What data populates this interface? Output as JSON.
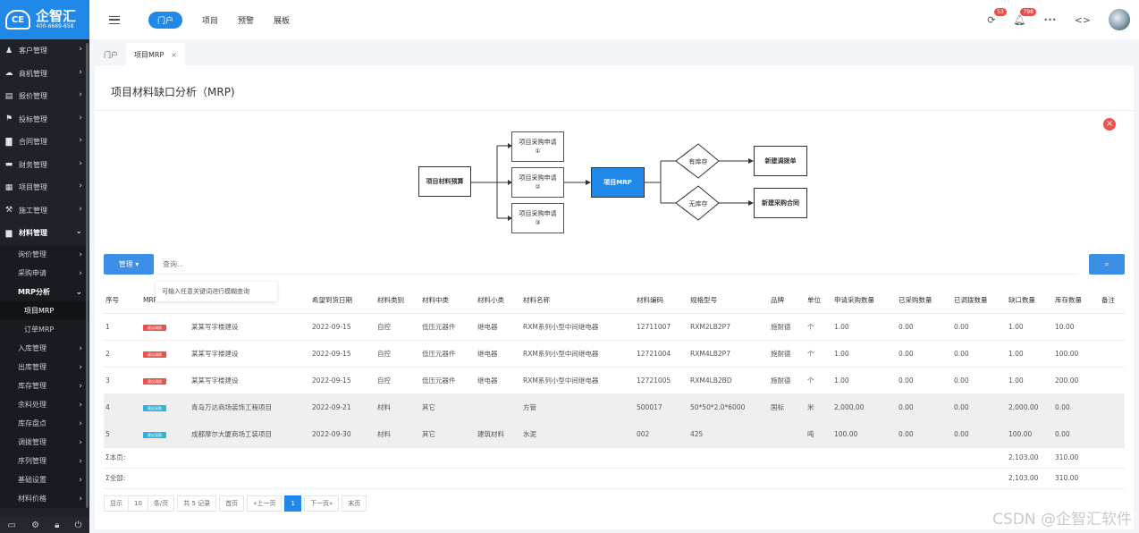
{
  "brand": {
    "name": "企智汇",
    "phone": "400-6689-658",
    "logo_mark": "CE"
  },
  "sidebar": {
    "items": [
      {
        "label": "客户管理",
        "icon": "users-icon"
      },
      {
        "label": "商机管理",
        "icon": "cloud-icon"
      },
      {
        "label": "报价管理",
        "icon": "document-icon"
      },
      {
        "label": "投标管理",
        "icon": "flag-icon"
      },
      {
        "label": "合同管理",
        "icon": "file-icon"
      },
      {
        "label": "财务管理",
        "icon": "card-icon"
      },
      {
        "label": "项目管理",
        "icon": "table-icon"
      },
      {
        "label": "施工管理",
        "icon": "wrench-icon"
      },
      {
        "label": "材料管理",
        "icon": "folder-icon"
      }
    ],
    "sub_items": [
      "询价管理",
      "采购申请",
      "MRP分析",
      "项目MRP",
      "订单MRP",
      "入库管理",
      "出库管理",
      "库存管理",
      "余料处理",
      "库存盘点",
      "调拨管理",
      "序列管理",
      "基础设置",
      "材料价格"
    ]
  },
  "topnav": {
    "items": [
      "门户",
      "项目",
      "预警",
      "展板"
    ],
    "badge1": "53",
    "badge2": "798",
    "more": "•••",
    "code": "<>"
  },
  "tabs": [
    {
      "label": "门户"
    },
    {
      "label": "项目MRP",
      "close": "×"
    }
  ],
  "page": {
    "title": "项目材料缺口分析（MRP)"
  },
  "flow": {
    "source": "项目材料预算",
    "req1": "项目采购申请",
    "req1n": "①",
    "req2": "项目采购申请",
    "req2n": "②",
    "req3": "项目采购申请",
    "req3n": "③",
    "mrp": "项目MRP",
    "has_stock": "有库存",
    "no_stock": "无库存",
    "out1": "新建调拨单",
    "out2": "新建采购合同"
  },
  "search": {
    "manage_label": "管理 ▾",
    "placeholder": "查询...",
    "tooltip": "可输入任意关键词进行模糊查询"
  },
  "table": {
    "headers": [
      "序号",
      "MRP",
      "",
      "希望到货日期",
      "材料类别",
      "材料中类",
      "材料小类",
      "材料名称",
      "材料编码",
      "规格型号",
      "品牌",
      "单位",
      "申请采购数量",
      "已采购数量",
      "已调拨数量",
      "缺口数量",
      "库存数量",
      "备注"
    ],
    "rows": [
      {
        "no": "1",
        "tag": "建议调拨",
        "proj": "某某写字楼建设",
        "date": "2022-09-15",
        "cat": "自控",
        "mid": "低压元器件",
        "small": "继电器",
        "name": "RXM系列小型中间继电器",
        "code": "12711007",
        "spec": "RXM2LB2P7",
        "brand": "施耐德",
        "unit": "个",
        "req": "1.00",
        "bought": "0.00",
        "moved": "0.00",
        "gap": "1.00",
        "stock": "10.00",
        "note": ""
      },
      {
        "no": "2",
        "tag": "建议调拨",
        "proj": "某某写字楼建设",
        "date": "2022-09-15",
        "cat": "自控",
        "mid": "低压元器件",
        "small": "继电器",
        "name": "RXM系列小型中间继电器",
        "code": "12721004",
        "spec": "RXM4LB2P7",
        "brand": "施耐德",
        "unit": "个",
        "req": "1.00",
        "bought": "0.00",
        "moved": "0.00",
        "gap": "1.00",
        "stock": "100.00",
        "note": ""
      },
      {
        "no": "3",
        "tag": "建议调拨",
        "proj": "某某写字楼建设",
        "date": "2022-09-15",
        "cat": "自控",
        "mid": "低压元器件",
        "small": "继电器",
        "name": "RXM系列小型中间继电器",
        "code": "12721005",
        "spec": "RXM4LB2BD",
        "brand": "施耐德",
        "unit": "个",
        "req": "1.00",
        "bought": "0.00",
        "moved": "0.00",
        "gap": "1.00",
        "stock": "200.00",
        "note": ""
      },
      {
        "no": "4",
        "tag": "建议采购",
        "proj": "青岛万达商场装饰工程项目",
        "date": "2022-09-21",
        "cat": "材料",
        "mid": "其它",
        "small": "",
        "name": "方管",
        "code": "500017",
        "spec": "50*50*2.0*6000",
        "brand": "国标",
        "unit": "米",
        "req": "2,000.00",
        "bought": "0.00",
        "moved": "0.00",
        "gap": "2,000.00",
        "stock": "0.00",
        "note": ""
      },
      {
        "no": "5",
        "tag": "建议采购",
        "proj": "成都摩尔大厦商场工装项目",
        "date": "2022-09-30",
        "cat": "材料",
        "mid": "其它",
        "small": "建筑材料",
        "name": "水泥",
        "code": "002",
        "spec": "425",
        "brand": "",
        "unit": "吨",
        "req": "100.00",
        "bought": "0.00",
        "moved": "0.00",
        "gap": "100.00",
        "stock": "0.00",
        "note": ""
      }
    ],
    "sum_page": {
      "label": "Σ本页:",
      "gap": "2,103.00",
      "stock": "310.00"
    },
    "sum_all": {
      "label": "Σ全部:",
      "gap": "2,103.00",
      "stock": "310.00"
    }
  },
  "pager": {
    "show": "显示",
    "size": "10",
    "per": "条/页",
    "total": "共 5 记录",
    "first": "首页",
    "prev": "«上一页",
    "current": "1",
    "next": "下一页»",
    "last": "末页"
  },
  "watermark": "CSDN @企智汇软件",
  "colors": {
    "primary": "#1f88e8",
    "tag_transfer": "#e8534a",
    "tag_purchase": "#35b3d6"
  }
}
